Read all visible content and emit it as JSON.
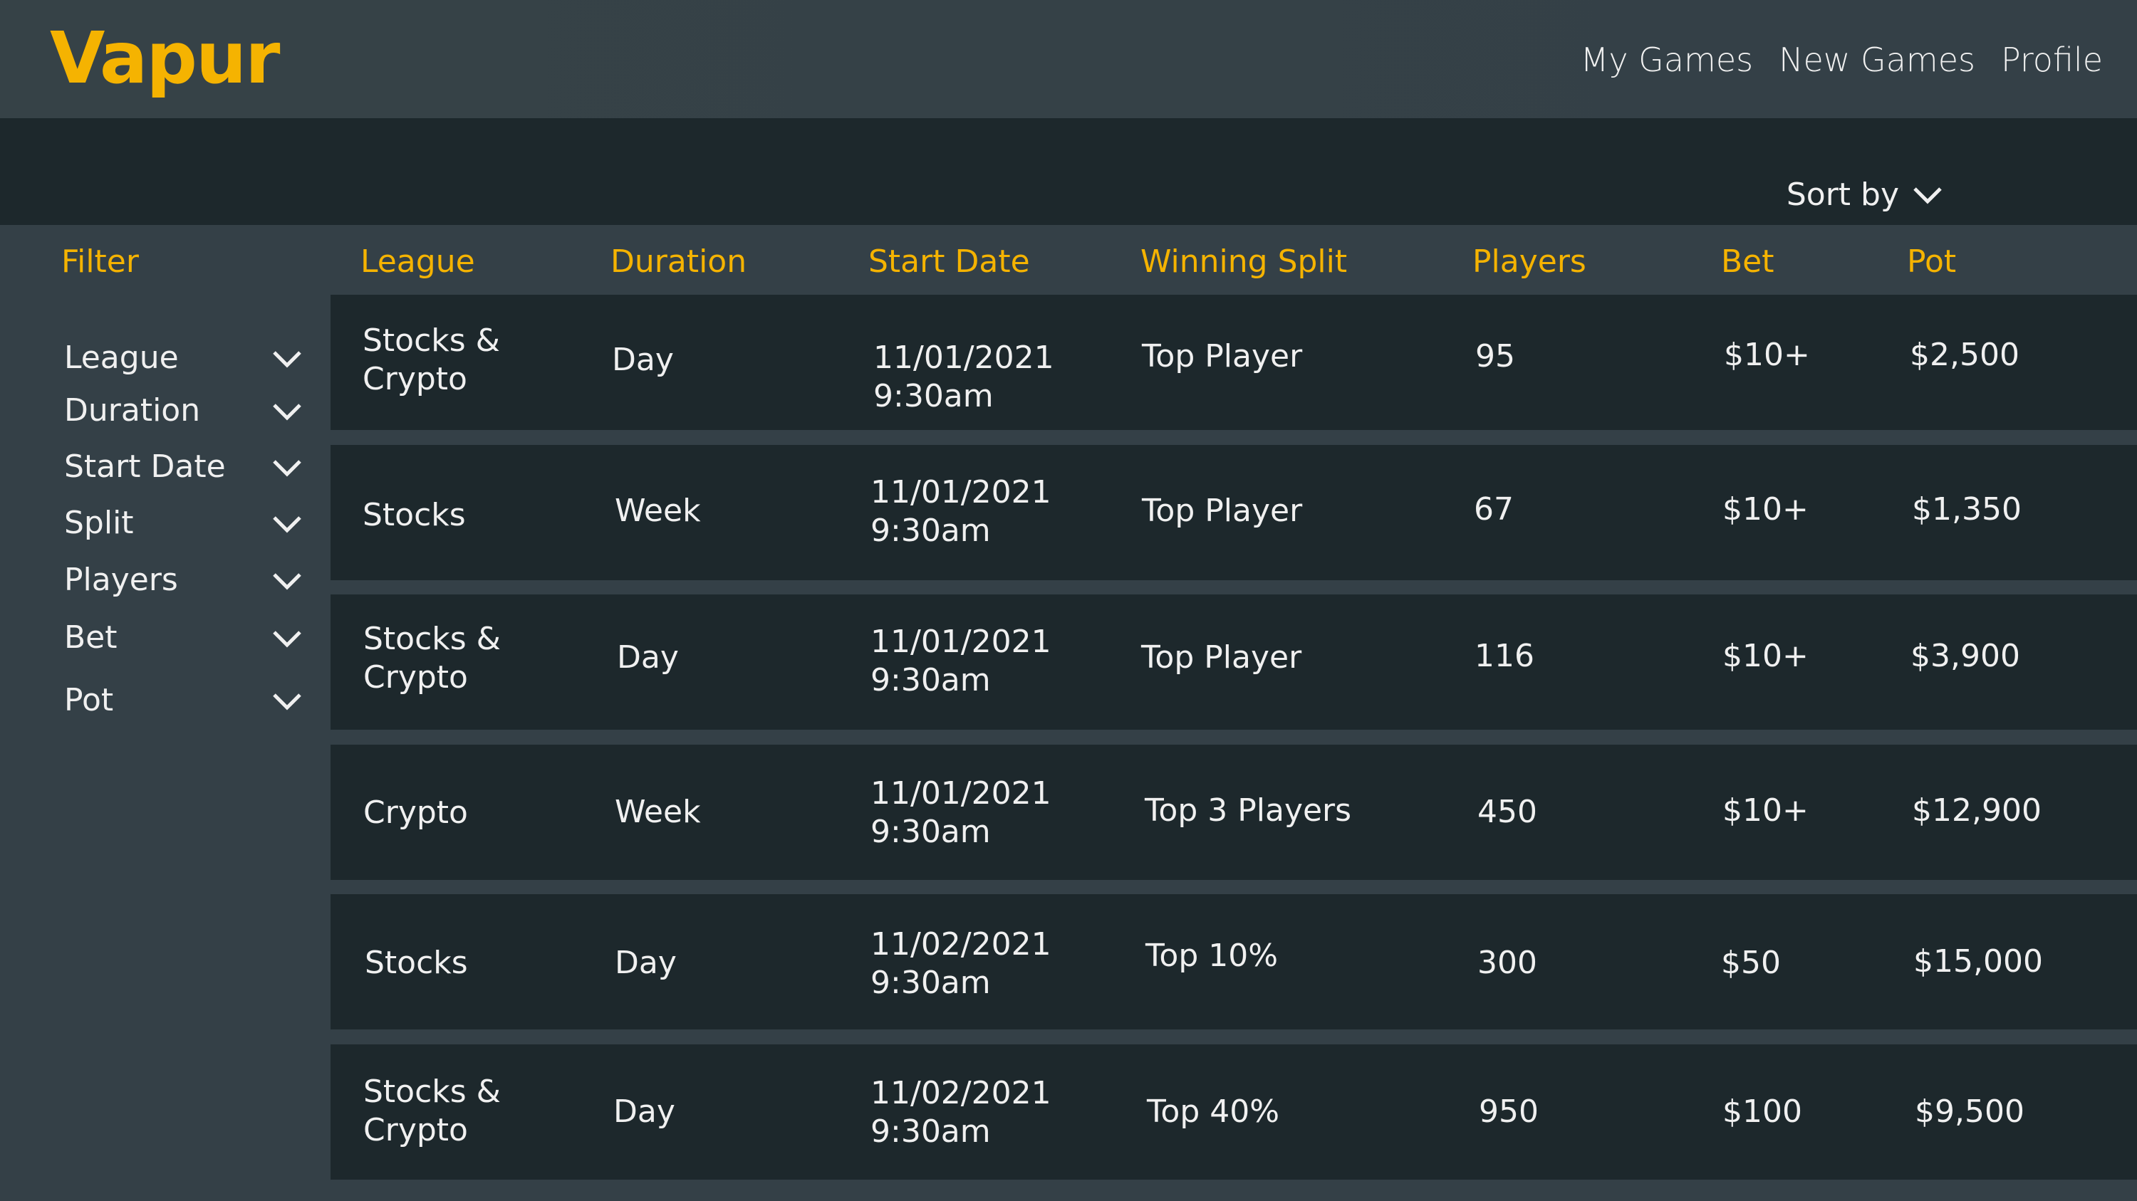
{
  "app": {
    "logo": "Vapur"
  },
  "nav": {
    "items": [
      "My Games",
      "New Games",
      "Profile"
    ]
  },
  "toolbar": {
    "sort_label": "Sort by"
  },
  "table": {
    "filter_header": "Filter",
    "columns": [
      "League",
      "Duration",
      "Start Date",
      "Winning Split",
      "Players",
      "Bet",
      "Pot"
    ],
    "rows": [
      {
        "league": "Stocks &\nCrypto",
        "duration": "Day",
        "start": "11/01/2021\n9:30am",
        "split": "Top Player",
        "players": "95",
        "bet": "$10+",
        "pot": "$2,500"
      },
      {
        "league": "Stocks",
        "duration": "Week",
        "start": "11/01/2021\n9:30am",
        "split": "Top Player",
        "players": "67",
        "bet": "$10+",
        "pot": "$1,350"
      },
      {
        "league": "Stocks &\nCrypto",
        "duration": "Day",
        "start": "11/01/2021\n9:30am",
        "split": "Top Player",
        "players": "116",
        "bet": "$10+",
        "pot": "$3,900"
      },
      {
        "league": "Crypto",
        "duration": "Week",
        "start": "11/01/2021\n9:30am",
        "split": "Top 3 Players",
        "players": "450",
        "bet": "$10+",
        "pot": "$12,900"
      },
      {
        "league": "Stocks",
        "duration": "Day",
        "start": "11/02/2021\n9:30am",
        "split": "Top 10%",
        "players": "300",
        "bet": "$50",
        "pot": "$15,000"
      },
      {
        "league": "Stocks &\nCrypto",
        "duration": "Day",
        "start": "11/02/2021\n9:30am",
        "split": "Top 40%",
        "players": "950",
        "bet": "$100",
        "pot": "$9,500"
      }
    ]
  },
  "sidebar": {
    "filters": [
      "League",
      "Duration",
      "Start Date",
      "Split",
      "Players",
      "Bet",
      "Pot"
    ]
  },
  "colors": {
    "accent": "#f5b301",
    "background": "#344047",
    "row_background": "#1d282c"
  }
}
